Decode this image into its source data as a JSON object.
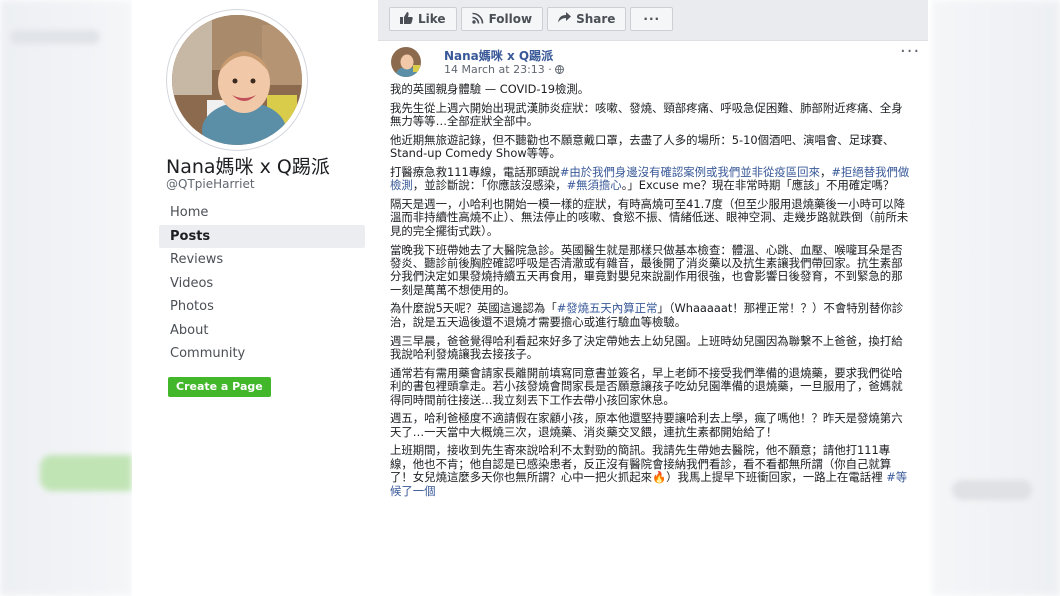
{
  "page": {
    "name": "Nana媽咪 x Q踢派",
    "handle": "@QTpieHarriet"
  },
  "nav": {
    "items": [
      {
        "label": "Home"
      },
      {
        "label": "Posts"
      },
      {
        "label": "Reviews"
      },
      {
        "label": "Videos"
      },
      {
        "label": "Photos"
      },
      {
        "label": "About"
      },
      {
        "label": "Community"
      }
    ],
    "active": "Posts"
  },
  "create_page_label": "Create a Page",
  "actions": {
    "like": "Like",
    "follow": "Follow",
    "share": "Share",
    "more": "···"
  },
  "post": {
    "author": "Nana媽咪 x Q踢派",
    "time": "14 March at 23:13 · ",
    "dots": "···",
    "paragraphs": [
      [
        {
          "t": "我的英國親身體驗 — COVID-19檢測。"
        }
      ],
      [
        {
          "t": "我先生從上週六開始出現武漢肺炎症狀：咳嗽、發燒、頸部疼痛、呼吸急促困難、肺部附近疼痛、全身無力等等…全部症狀全部中。"
        }
      ],
      [
        {
          "t": "他近期無旅遊記錄，但不聽勸也不願意戴口罩，去盡了人多的場所：5-10個酒吧、演唱會、足球賽、Stand-up Comedy Show等等。"
        }
      ],
      [
        {
          "t": "打醫療急救111專線，電話那頭說"
        },
        {
          "t": "#由於我們身邊沒有確認案例或我們並非從疫區回來",
          "tag": true
        },
        {
          "t": "，"
        },
        {
          "t": "#拒絕替我們做檢測",
          "tag": true
        },
        {
          "t": "，並診斷說：「你應該沒感染，"
        },
        {
          "t": "#無須擔心",
          "tag": true
        },
        {
          "t": "。」Excuse me？現在非常時期「應該」不用確定嗎？"
        }
      ],
      [
        {
          "t": "隔天是週一，小哈利也開始一模一樣的症狀，有時高燒可至41.7度（但至少服用退燒藥後一小時可以降溫而非持續性高燒不止）、無法停止的咳嗽、食慾不振、情緒低迷、眼神空洞、走幾步路就跌倒（前所未見的完全擺街式跌）。"
        }
      ],
      [
        {
          "t": "當晚我下班帶她去了大醫院急診。英國醫生就是那樣只做基本檢查：體溫、心跳、血壓、喉嚨耳朵是否發炎、聽診前後胸腔確認呼吸是否清澈或有雜音，最後開了消炎藥以及抗生素讓我們帶回家。抗生素部分我們決定如果發燒持續五天再食用，畢竟對嬰兒來說副作用很強，也會影響日後發育，不到緊急的那一刻是萬萬不想使用的。"
        }
      ],
      [
        {
          "t": "為什麼說5天呢？英國這邊認為「"
        },
        {
          "t": "#發燒五天內算正常",
          "tag": true
        },
        {
          "t": "」（Whaaaaat！那裡正常！？）不會特別替你診治，說是五天過後還不退燒才需要擔心或進行驗血等檢驗。"
        }
      ],
      [
        {
          "t": "週三早晨，爸爸覺得哈利看起來好多了決定帶她去上幼兒園。上班時幼兒園因為聯繫不上爸爸，換打給我說哈利發燒讓我去接孩子。"
        }
      ],
      [
        {
          "t": "通常若有需用藥會請家長離開前填寫同意書並簽名，早上老師不接受我們準備的退燒藥，要求我們從哈利的書包裡頭拿走。若小孩發燒會問家長是否願意讓孩子吃幼兒園準備的退燒藥，一旦服用了，爸媽就得同時間前往接送…我立刻丟下工作去帶小孩回家休息。"
        }
      ],
      [
        {
          "t": "週五，哈利爸極度不適請假在家顧小孩，原本他還堅持要讓哈利去上學，瘋了嗎他！？昨天是發燒第六天了…一天當中大概燒三次，退燒藥、消炎藥交叉餵，連抗生素都開始給了！"
        }
      ],
      [
        {
          "t": "上班期間，接收到先生寄來說哈利不太對勁的簡訊。我請先生帶她去醫院，他不願意；請他打111專線，他也不肯；他自認是已感染患者，反正沒有醫院會接納我們看診，看不看都無所謂（你自己就算了！女兒燒這麼多天你也無所謂？心中一把火抓起來🔥）我馬上提早下班衝回家，一路上在電話裡 "
        },
        {
          "t": "#等候了一個",
          "tag": true
        }
      ]
    ]
  }
}
